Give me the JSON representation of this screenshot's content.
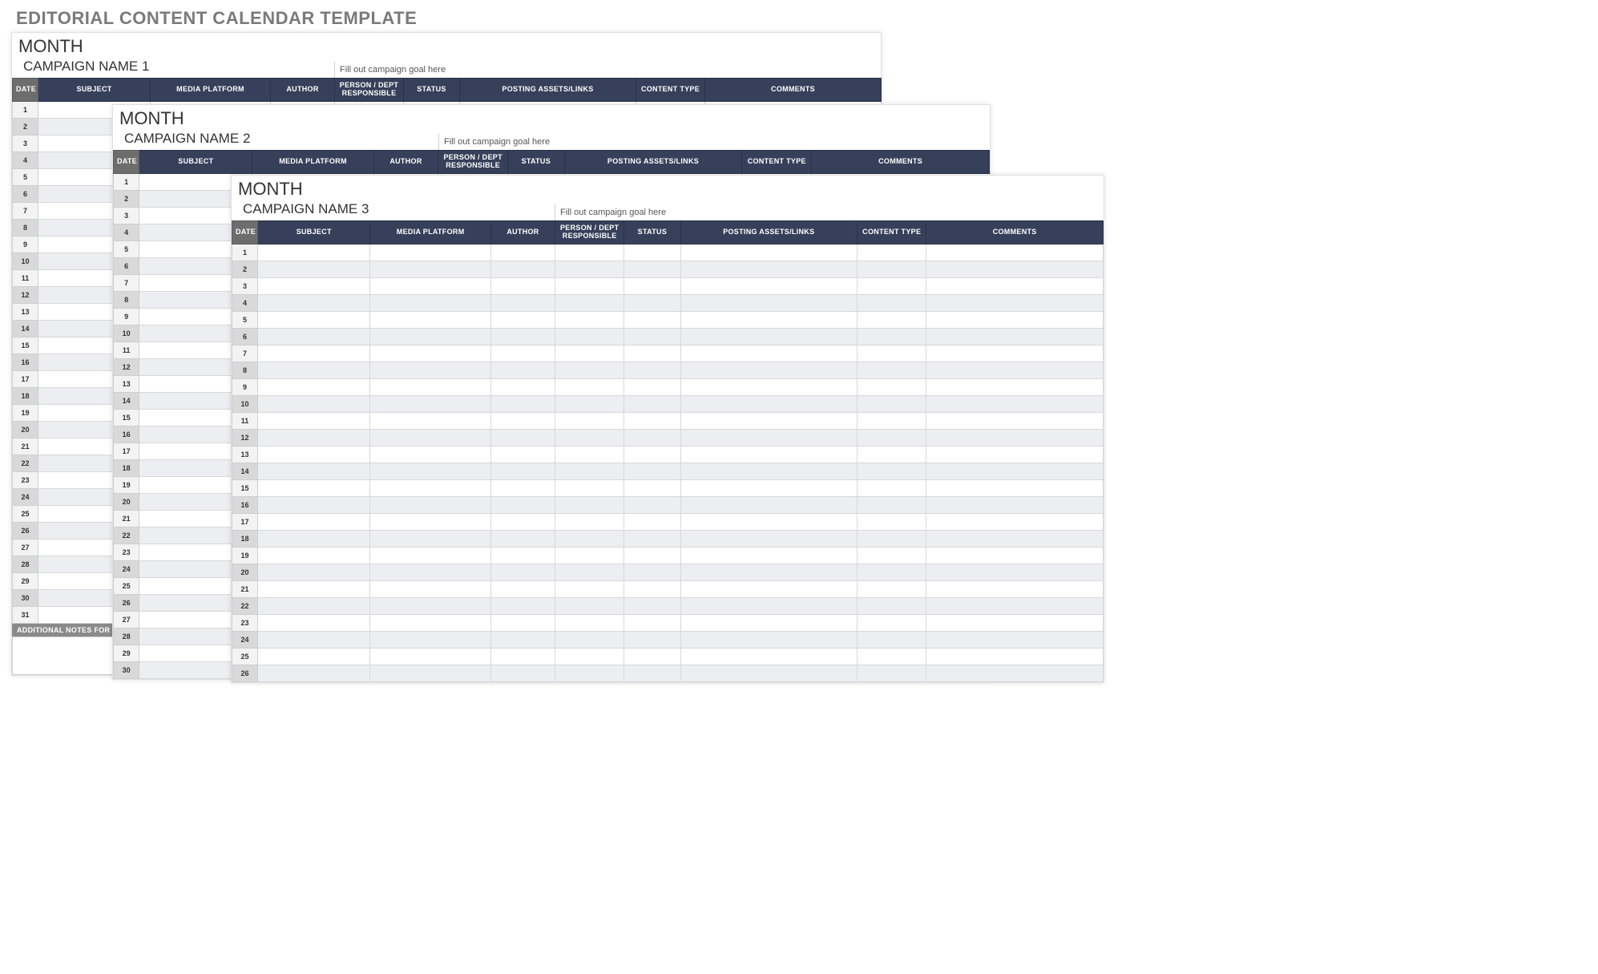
{
  "page_title": "EDITORIAL CONTENT CALENDAR TEMPLATE",
  "columns": [
    "DATE",
    "SUBJECT",
    "MEDIA PLATFORM",
    "AUTHOR",
    "PERSON / DEPT RESPONSIBLE",
    "STATUS",
    "POSTING ASSETS/LINKS",
    "CONTENT TYPE",
    "COMMENTS"
  ],
  "sheets": [
    {
      "month_label": "MONTH",
      "campaign_name": "CAMPAIGN NAME 1",
      "campaign_goal": "Fill out campaign goal here",
      "visible_days": 31,
      "footer_label": "ADDITIONAL NOTES FOR CAMPAIGN"
    },
    {
      "month_label": "MONTH",
      "campaign_name": "CAMPAIGN NAME 2",
      "campaign_goal": "Fill out campaign goal here",
      "visible_days": 30,
      "footer_label": ""
    },
    {
      "month_label": "MONTH",
      "campaign_name": "CAMPAIGN NAME 3",
      "campaign_goal": "Fill out campaign goal here",
      "visible_days": 26,
      "footer_label": ""
    }
  ]
}
